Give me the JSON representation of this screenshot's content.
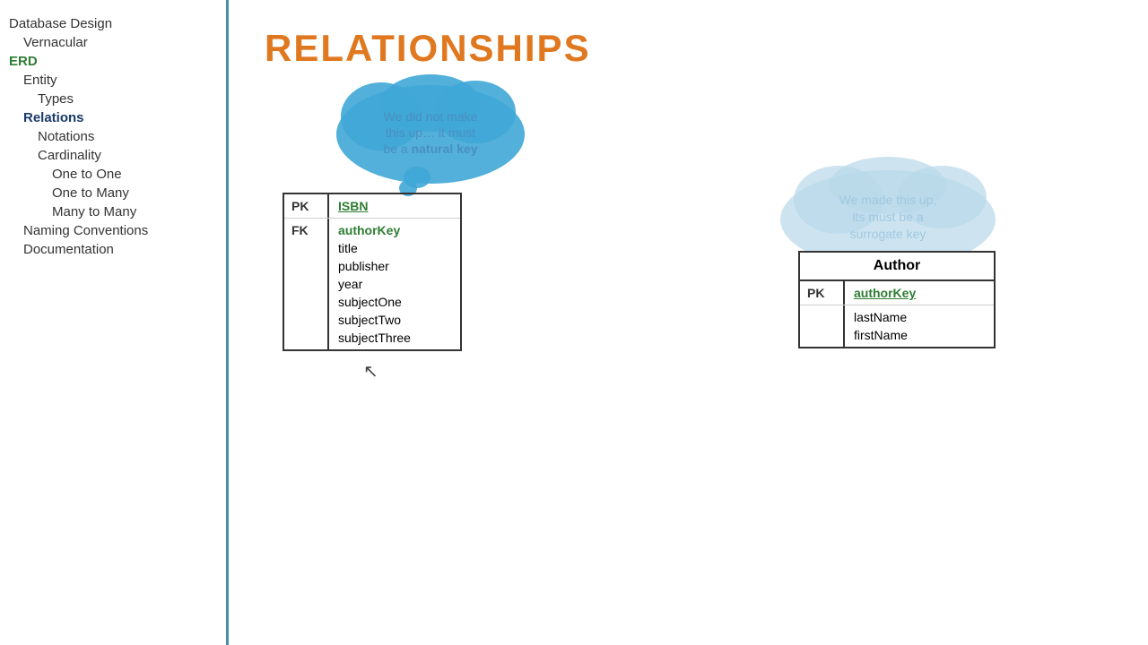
{
  "sidebar": {
    "items": [
      {
        "label": "Database Design",
        "level": 0,
        "style": "normal"
      },
      {
        "label": "Vernacular",
        "level": 1,
        "style": "normal"
      },
      {
        "label": "ERD",
        "level": 0,
        "style": "green-bold"
      },
      {
        "label": "Entity",
        "level": 1,
        "style": "normal"
      },
      {
        "label": "Types",
        "level": 2,
        "style": "normal"
      },
      {
        "label": "Relations",
        "level": 1,
        "style": "active"
      },
      {
        "label": "Notations",
        "level": 2,
        "style": "normal"
      },
      {
        "label": "Cardinality",
        "level": 2,
        "style": "normal"
      },
      {
        "label": "One to One",
        "level": 3,
        "style": "normal"
      },
      {
        "label": "One to Many",
        "level": 3,
        "style": "normal"
      },
      {
        "label": "Many to Many",
        "level": 3,
        "style": "normal"
      },
      {
        "label": "Naming Conventions",
        "level": 1,
        "style": "normal"
      },
      {
        "label": "Documentation",
        "level": 1,
        "style": "normal"
      }
    ]
  },
  "main": {
    "title": "RELATIONSHIPS",
    "cloud_left": {
      "line1": "We did not make",
      "line2": "this up… it must",
      "line3_pre": "be a ",
      "line3_bold": "natural key"
    },
    "cloud_right": {
      "line1": "We made this up,",
      "line2": "its must be a",
      "line3": "surrogate key"
    },
    "book_table": {
      "pk_label": "PK",
      "pk_value": "ISBN",
      "fk_label": "FK",
      "fields": [
        "authorKey",
        "title",
        "publisher",
        "year",
        "subjectOne",
        "subjectTwo",
        "subjectThree"
      ]
    },
    "author_table": {
      "title": "Author",
      "pk_label": "PK",
      "pk_value": "authorKey",
      "fields": [
        "lastName",
        "firstName"
      ]
    }
  }
}
